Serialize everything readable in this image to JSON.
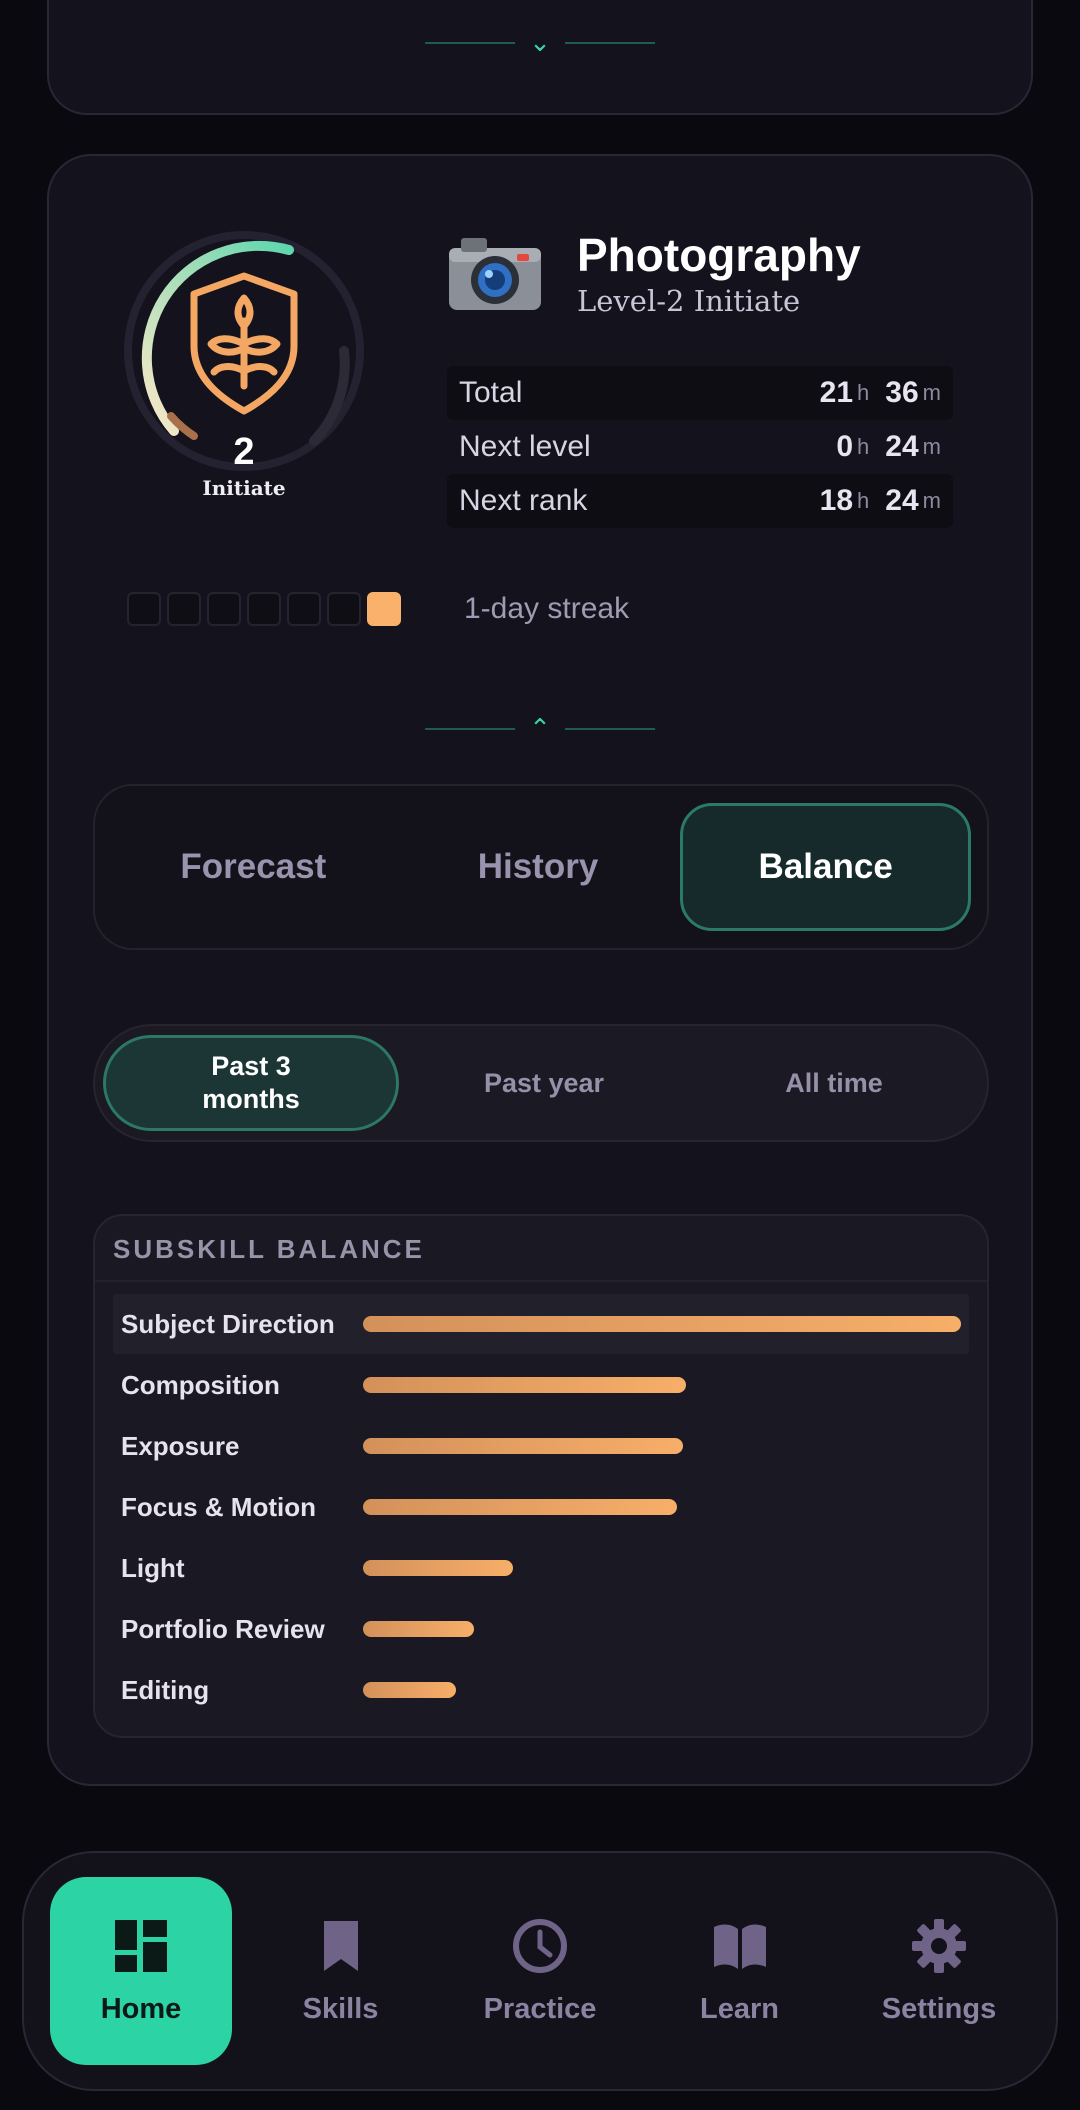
{
  "skill": {
    "title": "Photography",
    "subtitle": "Level-2 Initiate",
    "level_number": "2",
    "level_label": "Initiate",
    "progress_fraction": 0.33
  },
  "stats": [
    {
      "label": "Total",
      "hours": "21",
      "minutes": "36"
    },
    {
      "label": "Next level",
      "hours": "0",
      "minutes": "24"
    },
    {
      "label": "Next rank",
      "hours": "18",
      "minutes": "24"
    }
  ],
  "units": {
    "hours": "h",
    "minutes": "m"
  },
  "streak": {
    "days_shown": 7,
    "active_days": 1,
    "label": "1-day streak"
  },
  "tabs": [
    {
      "label": "Forecast",
      "active": false
    },
    {
      "label": "History",
      "active": false
    },
    {
      "label": "Balance",
      "active": true
    }
  ],
  "range": [
    {
      "label": "Past 3\nmonths",
      "active": true
    },
    {
      "label": "Past year",
      "active": false
    },
    {
      "label": "All time",
      "active": false
    }
  ],
  "balance": {
    "title": "SUBSKILL BALANCE",
    "items": [
      {
        "label": "Subject Direction",
        "value": 1.0
      },
      {
        "label": "Composition",
        "value": 0.54
      },
      {
        "label": "Exposure",
        "value": 0.535
      },
      {
        "label": "Focus & Motion",
        "value": 0.525
      },
      {
        "label": "Light",
        "value": 0.25
      },
      {
        "label": "Portfolio Review",
        "value": 0.185
      },
      {
        "label": "Editing",
        "value": 0.155
      }
    ]
  },
  "nav": [
    {
      "label": "Home",
      "icon": "dashboard-icon",
      "active": true
    },
    {
      "label": "Skills",
      "icon": "bookmark-icon",
      "active": false
    },
    {
      "label": "Practice",
      "icon": "clock-icon",
      "active": false
    },
    {
      "label": "Learn",
      "icon": "book-icon",
      "active": false
    },
    {
      "label": "Settings",
      "icon": "gear-icon",
      "active": false
    }
  ],
  "colors": {
    "accent": "#2cd3a5",
    "bar": "#f7ae69",
    "streak_on": "#f9b16c",
    "shield": "#f4a762"
  }
}
